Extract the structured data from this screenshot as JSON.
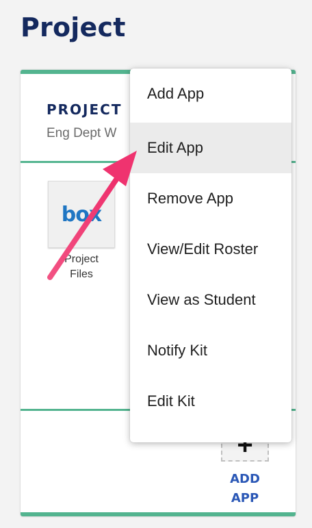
{
  "page": {
    "title": "Project"
  },
  "card": {
    "title": "PROJECT",
    "subtitle": "Eng Dept W"
  },
  "apps": [
    {
      "logo_text": "box",
      "label_line1": "Project",
      "label_line2": "Files"
    }
  ],
  "add_app": {
    "icon": "plus-icon",
    "label_line1": "ADD",
    "label_line2": "APP"
  },
  "context_menu": {
    "items": [
      {
        "label": "Add App",
        "highlighted": false
      },
      {
        "label": "Edit App",
        "highlighted": true
      },
      {
        "label": "Remove App",
        "highlighted": false
      },
      {
        "label": "View/Edit Roster",
        "highlighted": false
      },
      {
        "label": "View as Student",
        "highlighted": false
      },
      {
        "label": "Notify Kit",
        "highlighted": false
      },
      {
        "label": "Edit Kit",
        "highlighted": false
      }
    ]
  },
  "colors": {
    "brand_navy": "#14295e",
    "accent_green": "#53b48f",
    "box_blue": "#1f76c3",
    "add_app_blue": "#2a57b6",
    "annotation_pink": "#f03c74",
    "menu_highlight": "#ebebeb"
  }
}
